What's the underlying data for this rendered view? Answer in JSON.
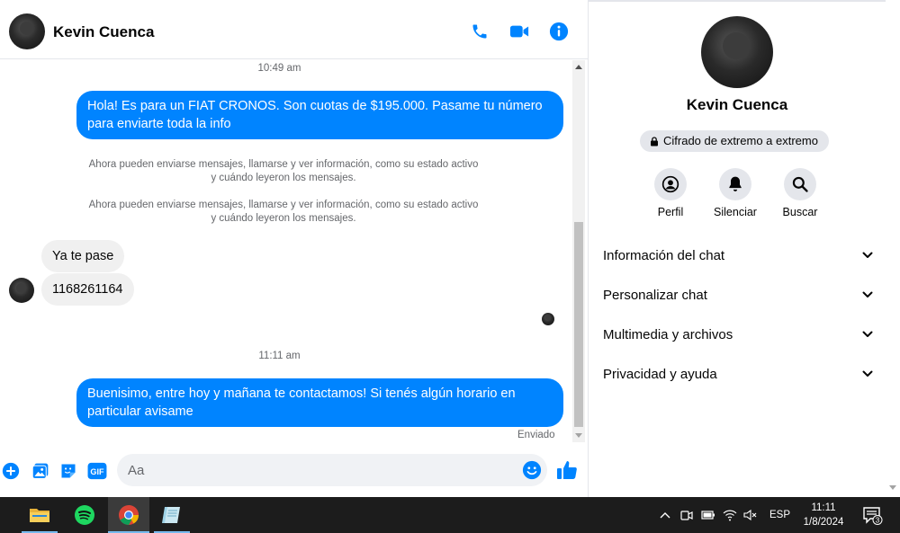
{
  "header": {
    "contact_name": "Kevin Cuenca",
    "icons": [
      "phone-icon",
      "video-icon",
      "info-icon"
    ]
  },
  "messages": {
    "time_1": "10:49 am",
    "outgoing_1": "Hola! Es para un FIAT CRONOS. Son cuotas de $195.000. Pasame tu número para enviarte toda la info",
    "system_1": "Ahora pueden enviarse mensajes, llamarse y ver información, como su estado activo y cuándo leyeron los mensajes.",
    "system_2": "Ahora pueden enviarse mensajes, llamarse y ver información, como su estado activo y cuándo leyeron los mensajes.",
    "incoming_1": "Ya te pase",
    "incoming_2": "1168261164",
    "time_2": "11:11 am",
    "outgoing_2": "Buenisimo, entre hoy y mañana te contactamos! Si tenés algún horario en particular avisame",
    "status": "Enviado"
  },
  "composer": {
    "placeholder": "Aa",
    "gif_label": "GIF"
  },
  "side_panel": {
    "name": "Kevin Cuenca",
    "encryption": "Cifrado de extremo a extremo",
    "actions": [
      {
        "label": "Perfil",
        "icon": "profile-icon"
      },
      {
        "label": "Silenciar",
        "icon": "bell-icon"
      },
      {
        "label": "Buscar",
        "icon": "search-icon"
      }
    ],
    "sections": [
      {
        "label": "Información del chat"
      },
      {
        "label": "Personalizar chat"
      },
      {
        "label": "Multimedia y archivos"
      },
      {
        "label": "Privacidad y ayuda"
      }
    ]
  },
  "taskbar": {
    "language": "ESP",
    "time": "11:11",
    "date": "1/8/2024",
    "notification_count": "3"
  },
  "colors": {
    "accent": "#0084ff",
    "bubble_in": "#f0f0f0",
    "taskbar": "#1c1c1c"
  }
}
